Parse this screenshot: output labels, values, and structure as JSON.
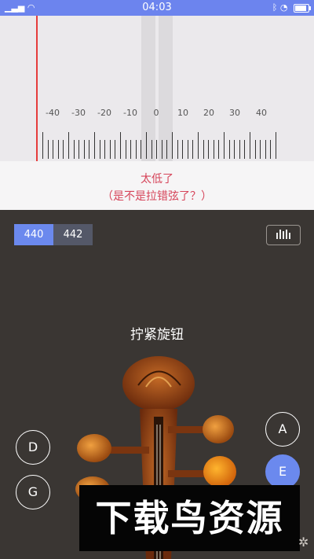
{
  "status_bar": {
    "time": "04:03",
    "left_icons": [
      "signal-icon",
      "wifi-icon"
    ],
    "right_icons": [
      "bluetooth-icon",
      "alarm-icon",
      "battery-icon"
    ]
  },
  "tuner": {
    "tick_labels": [
      "-40",
      "-30",
      "-20",
      "-10",
      "0",
      "10",
      "20",
      "30",
      "40"
    ],
    "needle_color": "#e63c3c"
  },
  "tuning_status": {
    "line1": "太低了",
    "line2": "（是不是拉错弦了？）"
  },
  "reference_freq": {
    "options": [
      "440",
      "442"
    ],
    "selected": "440"
  },
  "waveform_button": {
    "icon": "waveform-icon"
  },
  "instruction": "拧紧旋钮",
  "strings": {
    "left": [
      "D",
      "G"
    ],
    "right": [
      "A",
      "E"
    ],
    "selected": "E"
  },
  "watermark": "下载鸟资源",
  "colors": {
    "accent": "#6b89ee",
    "status_text": "#d6455a",
    "dark_background": "#3a3633"
  }
}
